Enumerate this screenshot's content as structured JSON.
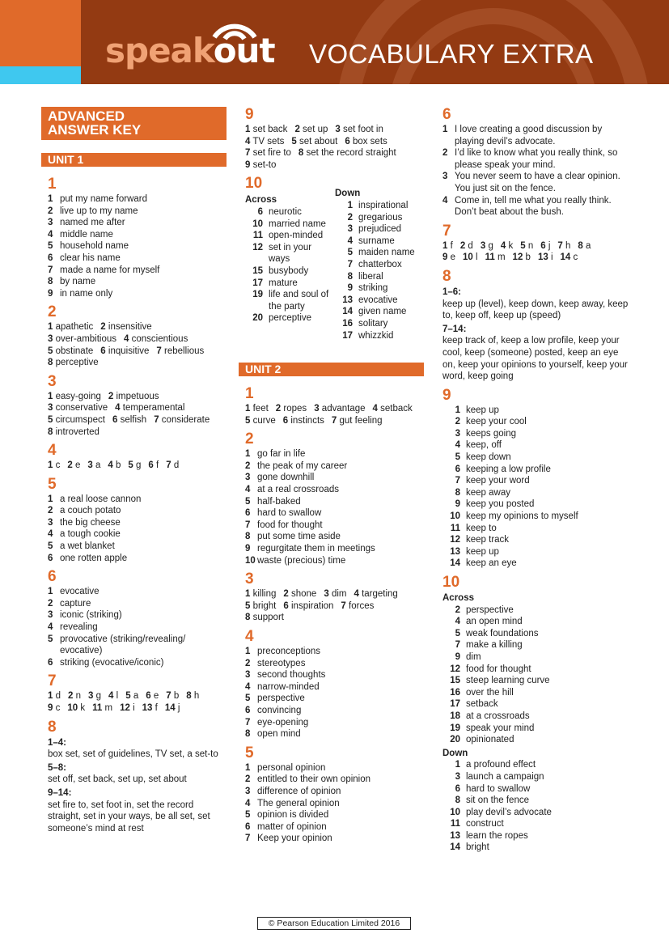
{
  "header": {
    "logo_part1": "speak",
    "logo_part2": "out",
    "title": "VOCABULARY EXTRA",
    "colors": {
      "banner": "#933a12",
      "accent": "#e06a2a",
      "blue": "#3fc8ef"
    }
  },
  "document_title_line1": "ADVANCED",
  "document_title_line2": "ANSWER KEY",
  "unit1": {
    "label": "UNIT 1",
    "ex1": {
      "num": "1",
      "items": [
        "put my name forward",
        "live up to my name",
        "named me after",
        "middle name",
        "household name",
        "clear his name",
        "made a name for myself",
        "by name",
        "in name only"
      ]
    },
    "ex2": {
      "num": "2",
      "lines": [
        [
          "1",
          "apathetic",
          "2",
          "insensitive"
        ],
        [
          "3",
          "over-ambitious",
          "4",
          "conscientious"
        ],
        [
          "5",
          "obstinate",
          "6",
          "inquisitive",
          "7",
          "rebellious"
        ],
        [
          "8",
          "perceptive"
        ]
      ]
    },
    "ex3": {
      "num": "3",
      "lines": [
        [
          "1",
          "easy-going",
          "2",
          "impetuous"
        ],
        [
          "3",
          "conservative",
          "4",
          "temperamental"
        ],
        [
          "5",
          "circumspect",
          "6",
          "selfish",
          "7",
          "considerate"
        ],
        [
          "8",
          "introverted"
        ]
      ]
    },
    "ex4": {
      "num": "4",
      "lines": [
        [
          "1",
          "c",
          "2",
          "e",
          "3",
          "a",
          "4",
          "b",
          "5",
          "g",
          "6",
          "f",
          "7",
          "d"
        ]
      ]
    },
    "ex5": {
      "num": "5",
      "items": [
        "a real loose cannon",
        "a couch potato",
        "the big cheese",
        "a tough cookie",
        "a wet blanket",
        "one rotten apple"
      ]
    },
    "ex6": {
      "num": "6",
      "items": [
        "evocative",
        "capture",
        "iconic (striking)",
        "revealing",
        "provocative (striking/revealing/ evocative)",
        "striking (evocative/iconic)"
      ]
    },
    "ex7": {
      "num": "7",
      "lines": [
        [
          "1",
          "d",
          "2",
          "n",
          "3",
          "g",
          "4",
          "l",
          "5",
          "a",
          "6",
          "e",
          "7",
          "b",
          "8",
          "h"
        ],
        [
          "9",
          "c",
          "10",
          "k",
          "11",
          "m",
          "12",
          "i",
          "13",
          "f",
          "14",
          "j"
        ]
      ]
    },
    "ex8": {
      "num": "8",
      "groups": [
        {
          "range": "1–4:",
          "text": "box set, set of guidelines, TV set, a set-to"
        },
        {
          "range": "5–8:",
          "text": "set off, set back, set up, set about"
        },
        {
          "range": "9–14:",
          "text": "set fire to, set foot in, set the record straight, set in your ways, be all set, set someone’s mind at rest"
        }
      ]
    },
    "ex9": {
      "num": "9",
      "lines": [
        [
          "1",
          "set back",
          "2",
          "set up",
          "3",
          "set foot in"
        ],
        [
          "4",
          "TV sets",
          "5",
          "set about",
          "6",
          "box sets"
        ],
        [
          "7",
          "set fire to",
          "8",
          "set the record straight"
        ],
        [
          "9",
          "set-to"
        ]
      ]
    },
    "ex10": {
      "num": "10",
      "across_label": "Across",
      "across": [
        [
          "6",
          "neurotic"
        ],
        [
          "10",
          "married name"
        ],
        [
          "11",
          "open-minded"
        ],
        [
          "12",
          "set in your ways"
        ],
        [
          "15",
          "busybody"
        ],
        [
          "17",
          "mature"
        ],
        [
          "19",
          "life and soul of the party"
        ],
        [
          "20",
          "perceptive"
        ]
      ],
      "down_label": "Down",
      "down": [
        [
          "1",
          "inspirational"
        ],
        [
          "2",
          "gregarious"
        ],
        [
          "3",
          "prejudiced"
        ],
        [
          "4",
          "surname"
        ],
        [
          "5",
          "maiden name"
        ],
        [
          "7",
          "chatterbox"
        ],
        [
          "8",
          "liberal"
        ],
        [
          "9",
          "striking"
        ],
        [
          "13",
          "evocative"
        ],
        [
          "14",
          "given name"
        ],
        [
          "16",
          "solitary"
        ],
        [
          "17",
          "whizzkid"
        ]
      ]
    }
  },
  "unit2": {
    "label": "UNIT 2",
    "ex1": {
      "num": "1",
      "lines": [
        [
          "1",
          "feet",
          "2",
          "ropes",
          "3",
          "advantage",
          "4",
          "setback"
        ],
        [
          "5",
          "curve",
          "6",
          "instincts",
          "7",
          "gut feeling"
        ]
      ]
    },
    "ex2": {
      "num": "2",
      "items": [
        "go far in life",
        "the peak of my career",
        "gone downhill",
        "at a real crossroads",
        "half-baked",
        "hard to swallow",
        "food for thought",
        "put some time aside",
        "regurgitate them in meetings",
        "waste (precious) time"
      ]
    },
    "ex3": {
      "num": "3",
      "lines": [
        [
          "1",
          "killing",
          "2",
          "shone",
          "3",
          "dim",
          "4",
          "targeting"
        ],
        [
          "5",
          "bright",
          "6",
          "inspiration",
          "7",
          "forces"
        ],
        [
          "8",
          "support"
        ]
      ]
    },
    "ex4": {
      "num": "4",
      "items": [
        "preconceptions",
        "stereotypes",
        "second thoughts",
        "narrow-minded",
        "perspective",
        "convincing",
        "eye-opening",
        "open mind"
      ]
    },
    "ex5": {
      "num": "5",
      "items": [
        "personal opinion",
        "entitled to their own opinion",
        "difference of opinion",
        "The general opinion",
        "opinion is divided",
        "matter of opinion",
        "Keep your opinion"
      ]
    },
    "ex6": {
      "num": "6",
      "items": [
        "I love creating a good discussion by playing devil’s advocate.",
        "I’d like to know what you really think, so please speak your mind.",
        "You never seem to have a clear opinion. You just sit on the fence.",
        "Come in, tell me what you really think. Don’t beat about the bush."
      ]
    },
    "ex7": {
      "num": "7",
      "lines": [
        [
          "1",
          "f",
          "2",
          "d",
          "3",
          "g",
          "4",
          "k",
          "5",
          "n",
          "6",
          "j",
          "7",
          "h",
          "8",
          "a"
        ],
        [
          "9",
          "e",
          "10",
          "l",
          "11",
          "m",
          "12",
          "b",
          "13",
          "i",
          "14",
          "c"
        ]
      ]
    },
    "ex8": {
      "num": "8",
      "groups": [
        {
          "range": "1–6:",
          "text": "keep up (level), keep down, keep away, keep to, keep off, keep up (speed)"
        },
        {
          "range": "7–14:",
          "text": "keep track of, keep a low profile, keep your cool, keep (someone) posted, keep an eye on, keep your opinions to yourself, keep your word, keep going"
        }
      ]
    },
    "ex9": {
      "num": "9",
      "items": [
        [
          "1",
          "keep up"
        ],
        [
          "2",
          "keep your cool"
        ],
        [
          "3",
          "keeps going"
        ],
        [
          "4",
          "keep, off"
        ],
        [
          "5",
          "keep down"
        ],
        [
          "6",
          "keeping a low profile"
        ],
        [
          "7",
          "keep your word"
        ],
        [
          "8",
          "keep away"
        ],
        [
          "9",
          "keep you posted"
        ],
        [
          "10",
          "keep my opinions to myself"
        ],
        [
          "11",
          "keep to"
        ],
        [
          "12",
          "keep track"
        ],
        [
          "13",
          "keep up"
        ],
        [
          "14",
          "keep an eye"
        ]
      ]
    },
    "ex10": {
      "num": "10",
      "across_label": "Across",
      "across": [
        [
          "2",
          "perspective"
        ],
        [
          "4",
          "an open mind"
        ],
        [
          "5",
          "weak foundations"
        ],
        [
          "7",
          "make a killing"
        ],
        [
          "9",
          "dim"
        ],
        [
          "12",
          "food for thought"
        ],
        [
          "15",
          "steep learning curve"
        ],
        [
          "16",
          "over the hill"
        ],
        [
          "17",
          "setback"
        ],
        [
          "18",
          "at a crossroads"
        ],
        [
          "19",
          "speak your mind"
        ],
        [
          "20",
          "opinionated"
        ]
      ],
      "down_label": "Down",
      "down": [
        [
          "1",
          "a profound effect"
        ],
        [
          "3",
          "launch a campaign"
        ],
        [
          "6",
          "hard to swallow"
        ],
        [
          "8",
          "sit on the fence"
        ],
        [
          "10",
          "play devil’s advocate"
        ],
        [
          "11",
          "construct"
        ],
        [
          "13",
          "learn the ropes"
        ],
        [
          "14",
          "bright"
        ]
      ]
    }
  },
  "footer": "© Pearson Education Limited 2016"
}
